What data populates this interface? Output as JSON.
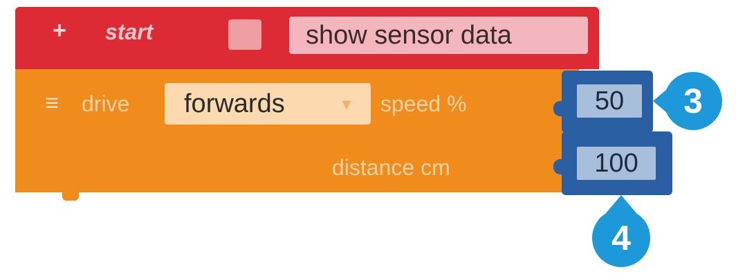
{
  "start_block": {
    "label": "start",
    "expand_icon": "+",
    "dropdown_value": "show sensor data"
  },
  "drive_block": {
    "label": "drive",
    "handle_icon": "≡",
    "direction_value": "forwards",
    "direction_caret": "▾",
    "speed_label": "speed %",
    "speed_value": "50",
    "distance_label": "distance cm",
    "distance_value": "100"
  },
  "callouts": {
    "speed": "3",
    "distance": "4"
  },
  "colors": {
    "start_block": "#dc2b35",
    "drive_block": "#ef8c1c",
    "number_block": "#2a5fa3",
    "callout_badge": "#1d98d9"
  }
}
